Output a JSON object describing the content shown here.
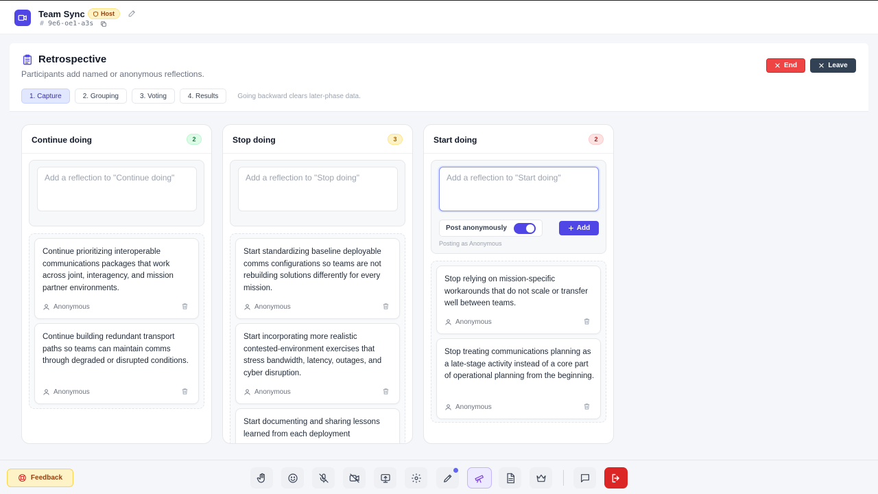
{
  "app": {
    "title": "Team Sync",
    "role_badge": "Host",
    "room_code": "9e6-oe1-a3s",
    "room_hash": "#"
  },
  "retro": {
    "title": "Retrospective",
    "subtitle": "Participants add named or anonymous reflections.",
    "phases": [
      "1. Capture",
      "2. Grouping",
      "3. Voting",
      "4. Results"
    ],
    "active_phase": "1. Capture",
    "phase_note": "Going backward clears later-phase data.",
    "end_label": "End",
    "leave_label": "Leave"
  },
  "columns": [
    {
      "title": "Continue doing",
      "count": "2",
      "count_bg": "#dcfce7",
      "count_color": "#15803d",
      "placeholder": "Add a reflection to \"Continue doing\"",
      "cards": [
        {
          "text": "Continue prioritizing interoperable communications packages that work across joint, interagency, and mission partner environments.",
          "author": "Anonymous"
        },
        {
          "text": "Continue building redundant transport paths so teams can maintain comms through degraded or disrupted conditions.",
          "author": "Anonymous"
        }
      ]
    },
    {
      "title": "Stop doing",
      "count": "3",
      "count_bg": "#fef3c7",
      "count_color": "#a16207",
      "placeholder": "Add a reflection to \"Stop doing\"",
      "cards": [
        {
          "text": "Start standardizing baseline deployable comms configurations so teams are not rebuilding solutions differently for every mission.",
          "author": "Anonymous"
        },
        {
          "text": "Start incorporating more realistic contested-environment exercises that stress bandwidth, latency, outages, and cyber disruption.",
          "author": "Anonymous"
        },
        {
          "text": "Start documenting and sharing lessons learned from each deployment"
        }
      ]
    },
    {
      "title": "Start doing",
      "count": "2",
      "count_bg": "#fee2e2",
      "count_color": "#b91c1c",
      "placeholder": "Add a reflection to \"Start doing\"",
      "anon_label": "Post anonymously",
      "add_label": "Add",
      "posting_as": "Posting as Anonymous",
      "cards": [
        {
          "text": "Stop relying on mission-specific workarounds that do not scale or transfer well between teams.",
          "author": "Anonymous"
        },
        {
          "text": "Stop treating communications planning as a late-stage activity instead of a core part of operational planning from the beginning.",
          "author": "Anonymous"
        }
      ]
    }
  ],
  "bottom": {
    "feedback_label": "Feedback",
    "tools": [
      "raise-hand-icon",
      "emoji-icon",
      "mic-off-icon",
      "camera-off-icon",
      "screen-share-icon",
      "settings-icon",
      "draw-icon",
      "retro-icon",
      "notes-icon",
      "crown-icon"
    ],
    "chat": "chat-icon",
    "exit": "exit-icon"
  }
}
